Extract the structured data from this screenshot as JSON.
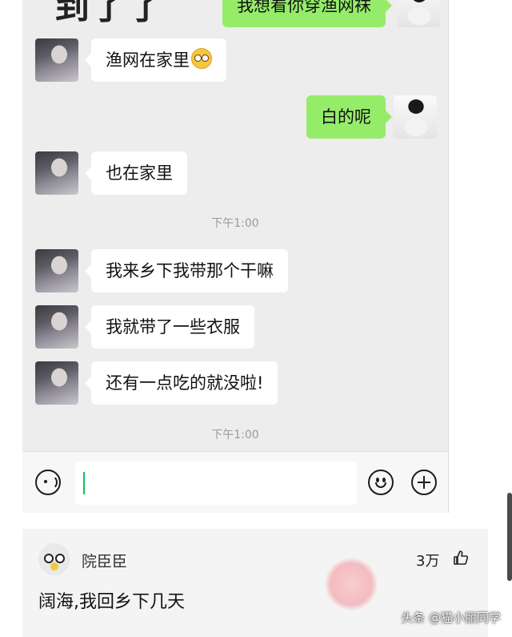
{
  "chat": {
    "partial_header_text": "到了了",
    "messages": [
      {
        "side": "right",
        "text": "我想看你穿渔网袜"
      },
      {
        "side": "left",
        "text": "渔网在家里",
        "emoji": "nerd-face-emoji"
      },
      {
        "side": "right",
        "text": "白的呢"
      },
      {
        "side": "left",
        "text": "也在家里"
      },
      {
        "side": "left",
        "text": "我来乡下我带那个干嘛"
      },
      {
        "side": "left",
        "text": "我就带了一些衣服"
      },
      {
        "side": "left",
        "text": "还有一点吃的就没啦!"
      }
    ],
    "timestamps": [
      "下午1:00",
      "下午1:00"
    ],
    "colors": {
      "sent_bubble": "#95ec69",
      "received_bubble": "#ffffff",
      "background": "#ededed",
      "caret": "#07c160"
    }
  },
  "input_bar": {
    "icons": [
      "voice-icon",
      "emoji-icon",
      "plus-icon"
    ],
    "value": ""
  },
  "comment": {
    "username": "院臣臣",
    "likes": "3万",
    "text": "阔海,我回乡下几天"
  },
  "watermark": "头条 @猫小丽同学"
}
